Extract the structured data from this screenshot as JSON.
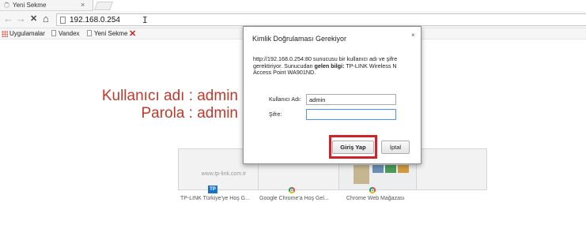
{
  "tab": {
    "title": "Yeni Sekme",
    "close": "×"
  },
  "toolbar": {
    "back": "←",
    "forward": "→",
    "stop": "✕",
    "home": "⌂",
    "url": "192.168.0.254",
    "cursor": "I"
  },
  "bookmarks": {
    "apps": "Uygulamalar",
    "items": [
      "Vandex",
      "Yeni Sekme"
    ],
    "extra_icon": "red-x-icon"
  },
  "page": {
    "hint_user": "Kullanıcı adı : admin",
    "hint_pass": "Parola : admin",
    "thumbnails": [
      {
        "label": "TP-LINK Türkiye'ye Hoş G...",
        "url": "www.tp-link.com.tr",
        "logo": "TP"
      },
      {
        "label": "Google Chrome'a Hoş Gel..."
      },
      {
        "label": "Chrome Web Mağazası"
      }
    ]
  },
  "dialog": {
    "title": "Kimlik Doğrulaması Gerekiyor",
    "close": "×",
    "message_1": "http://192.168.0.254:80 sunucusu bir kullanıcı adı ve şifre gerektiriyor. Sunucudan ",
    "message_bold": "gelen bilgi:",
    "message_2": " TP-LINK Wireless N Access Point WA901ND.",
    "username_label": "Kullanıcı Adı:",
    "username_value": "admin",
    "password_label": "Şifre:",
    "password_value": "",
    "login_button": "Giriş Yap",
    "cancel_button": "İptal"
  },
  "colors": {
    "hint": "#c0392b",
    "highlight": "#d0222b"
  }
}
